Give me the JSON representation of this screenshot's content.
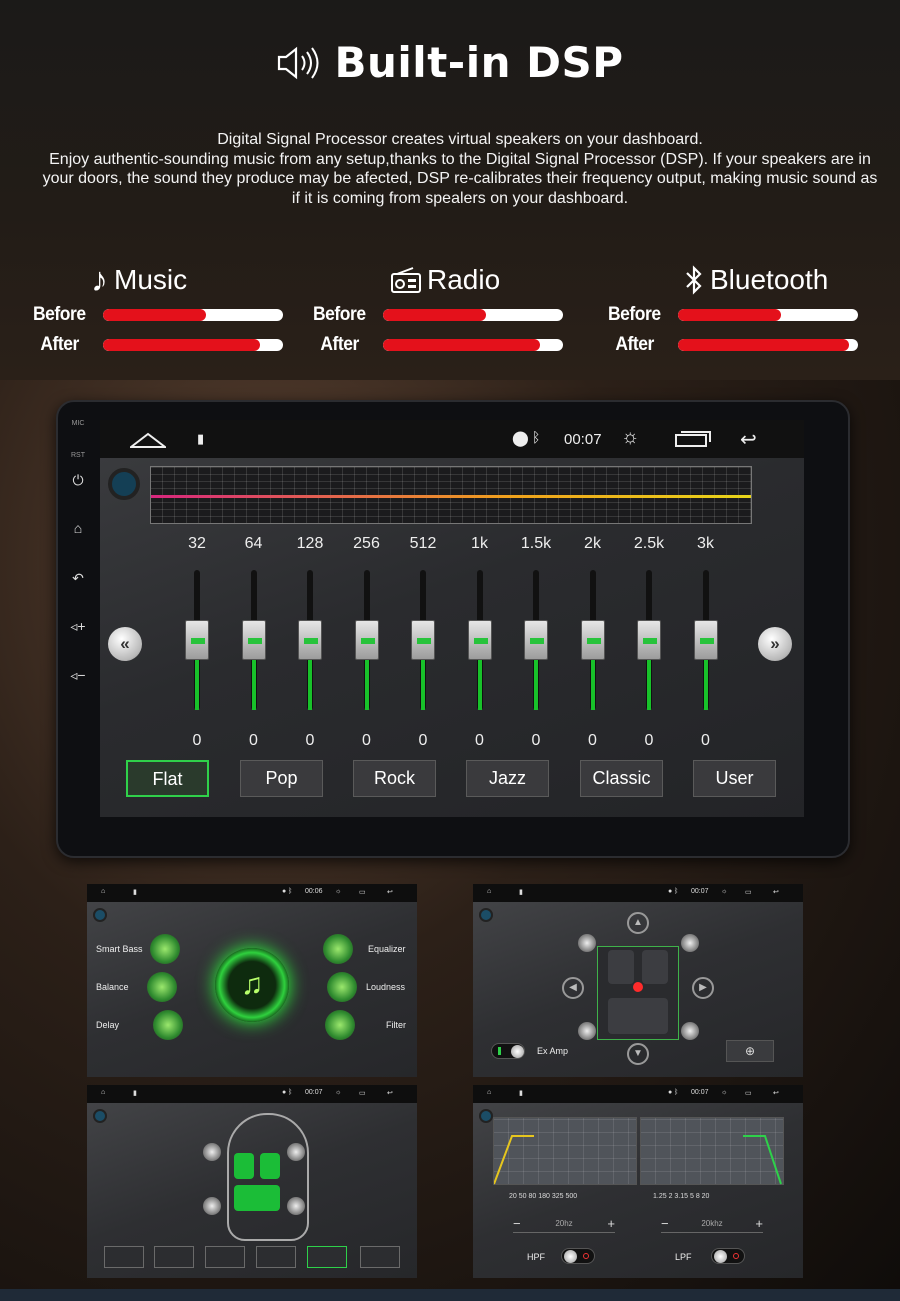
{
  "header": {
    "title": "Built-in DSP",
    "icon": "speaker-sound-icon"
  },
  "description": {
    "line1": "Digital Signal Processor creates virtual speakers on your dashboard.",
    "line2": "Enjoy authentic-sounding music from any setup,thanks to the Digital Signal Processor (DSP). If your speakers are in your doors, the sound they produce may be afected, DSP re-calibrates their frequency output, making music sound as if it is coming from spealers on your dashboard."
  },
  "comparisons": [
    {
      "title": "Music",
      "icon": "music-note-icon",
      "before_label": "Before",
      "after_label": "After",
      "before_level": 0.57,
      "after_level": 0.87
    },
    {
      "title": "Radio",
      "icon": "radio-icon",
      "before_label": "Before",
      "after_label": "After",
      "before_level": 0.57,
      "after_level": 0.87
    },
    {
      "title": "Bluetooth",
      "icon": "bluetooth-icon",
      "before_label": "Before",
      "after_label": "After",
      "before_level": 0.57,
      "after_level": 0.95
    }
  ],
  "colors": {
    "accent_red": "#e4111b",
    "accent_green": "#18c22a"
  },
  "tablet": {
    "side_labels": {
      "mic": "MIC",
      "rst": "RST"
    },
    "status": {
      "time": "00:07"
    },
    "equalizer": {
      "frequencies": [
        "32",
        "64",
        "128",
        "256",
        "512",
        "1k",
        "1.5k",
        "2k",
        "2.5k",
        "3k"
      ],
      "values": [
        "0",
        "0",
        "0",
        "0",
        "0",
        "0",
        "0",
        "0",
        "0",
        "0"
      ]
    },
    "presets": [
      {
        "label": "Flat",
        "active": true
      },
      {
        "label": "Pop",
        "active": false
      },
      {
        "label": "Rock",
        "active": false
      },
      {
        "label": "Jazz",
        "active": false
      },
      {
        "label": "Classic",
        "active": false
      },
      {
        "label": "User",
        "active": false
      }
    ]
  },
  "screen1": {
    "time": "00:06",
    "left": [
      "Smart Bass",
      "Balance",
      "Delay"
    ],
    "right": [
      "Equalizer",
      "Loudness",
      "Filter"
    ]
  },
  "screen2": {
    "time": "00:07",
    "ex_amp": "Ex Amp"
  },
  "screen3": {
    "time": "00:07"
  },
  "screen4": {
    "time": "00:07",
    "hpf_ticks": "20   50   80   180  325  500",
    "lpf_ticks": "1.25   2   3.15   5    8    20",
    "hpf_value": "20hz",
    "lpf_value": "20khz",
    "hpf_label": "HPF",
    "lpf_label": "LPF"
  }
}
